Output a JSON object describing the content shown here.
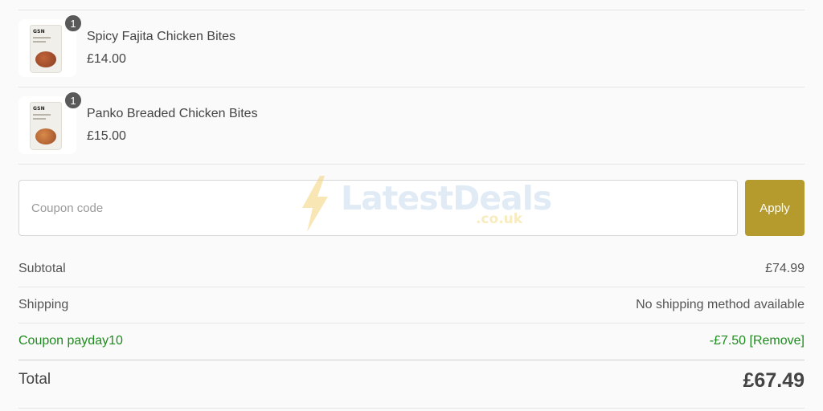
{
  "cart": {
    "items": [
      {
        "name": "Spicy Fajita Chicken Bites",
        "price": "£14.00",
        "quantity": "1",
        "brand": "GSN"
      },
      {
        "name": "Panko Breaded Chicken Bites",
        "price": "£15.00",
        "quantity": "1",
        "brand": "GSN"
      }
    ]
  },
  "coupon": {
    "placeholder": "Coupon code",
    "value": "",
    "apply_label": "Apply"
  },
  "summary": {
    "subtotal_label": "Subtotal",
    "subtotal_value": "£74.99",
    "shipping_label": "Shipping",
    "shipping_value": "No shipping method available",
    "coupon_label": "Coupon payday10",
    "coupon_value": "-£7.50",
    "coupon_remove": "[Remove]",
    "total_label": "Total",
    "total_value": "£67.49"
  },
  "watermark": {
    "text": "LatestDeals",
    "subtext": ".co.uk"
  },
  "colors": {
    "accent": "#b59a2e",
    "discount": "#1f8a1f",
    "badge": "#595959"
  }
}
